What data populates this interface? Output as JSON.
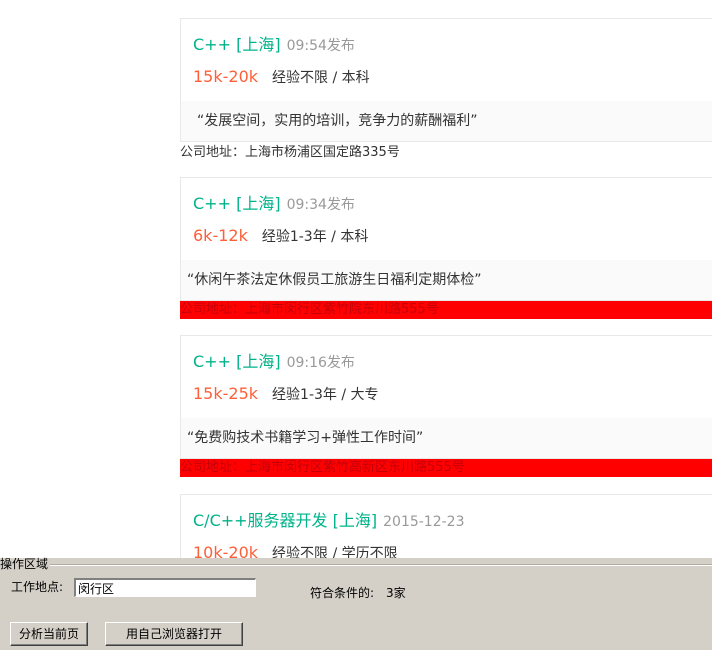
{
  "jobs": [
    {
      "title": "C++ [上海]",
      "time": "09:54发布",
      "salary": "15k-20k",
      "requirements": "经验不限 / 本科",
      "advantage": "“发展空间，实用的培训，竞争力的薪酬福利”",
      "address": "公司地址：上海市杨浦区国定路335号"
    },
    {
      "title": "C++ [上海]",
      "time": "09:34发布",
      "salary": "6k-12k",
      "requirements": "经验1-3年 / 本科",
      "advantage": "“休闲午茶法定休假员工旅游生日福利定期体检”",
      "address": "公司地址：上海市闵行区紫竹院东川路555号"
    },
    {
      "title": "C++ [上海]",
      "time": "09:16发布",
      "salary": "15k-25k",
      "requirements": "经验1-3年 / 大专",
      "advantage": "“免费购技术书籍学习+弹性工作时间”",
      "address": "公司地址：上海市闵行区紫竹高新区东川路555号"
    },
    {
      "title": "C/C++服务器开发 [上海]",
      "time": "2015-12-23",
      "salary": "10k-20k",
      "requirements": "经验不限 / 学历不限",
      "advantage": "",
      "address": ""
    }
  ],
  "panel": {
    "group_title": "操作区域",
    "location_label": "工作地点:",
    "location_value": "闵行区",
    "count_label": "符合条件的:",
    "count_value": "3家",
    "analyze_button": "分析当前页",
    "open_browser_button": "用自己浏览器打开"
  }
}
